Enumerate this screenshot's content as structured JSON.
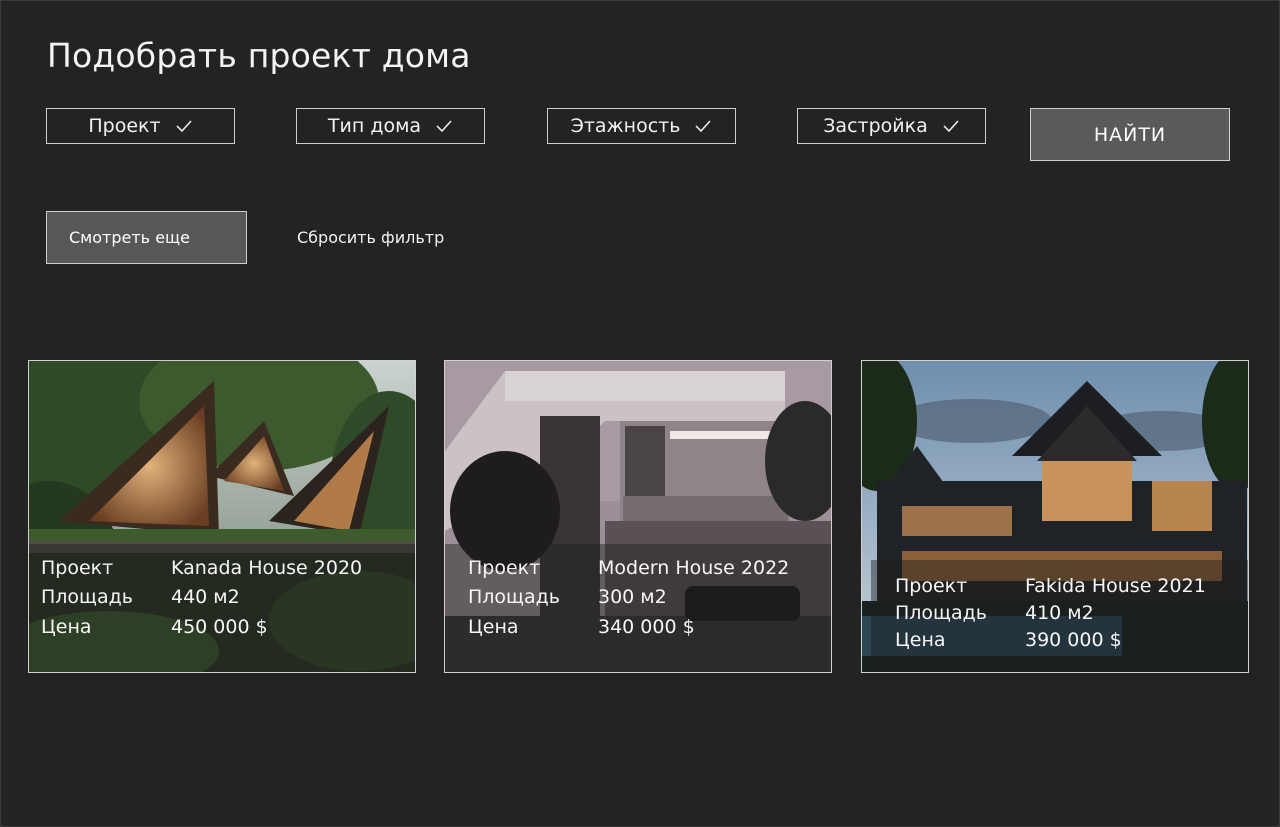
{
  "page": {
    "title": "Подобрать проект дома"
  },
  "filters": [
    {
      "label": "Проект"
    },
    {
      "label": "Тип дома"
    },
    {
      "label": "Этажность"
    },
    {
      "label": "Застройка"
    }
  ],
  "actions": {
    "find_label": "НАЙТИ",
    "more_label": "Смотреть еще",
    "reset_label": "Сбросить фильтр"
  },
  "cards": [
    {
      "project_label": "Проект",
      "project": "Kanada House 2020",
      "area_label": "Площадь",
      "area": "440 м2",
      "price_label": "Цена",
      "price": "450 000 $"
    },
    {
      "project_label": "Проект",
      "project": "Modern House 2022",
      "area_label": "Площадь",
      "area": "300 м2",
      "price_label": "Цена",
      "price": "340 000 $"
    },
    {
      "project_label": "Проект",
      "project": "Fakida House 2021",
      "area_label": "Площадь",
      "area": "410 м2",
      "price_label": "Цена",
      "price": "390 000 $"
    }
  ],
  "icons": {
    "filter_check": "checkmark-icon"
  },
  "colors": {
    "background": "#232323",
    "button_fill": "#5a5a5a",
    "border": "#cfcfcf",
    "text": "#ffffff"
  }
}
